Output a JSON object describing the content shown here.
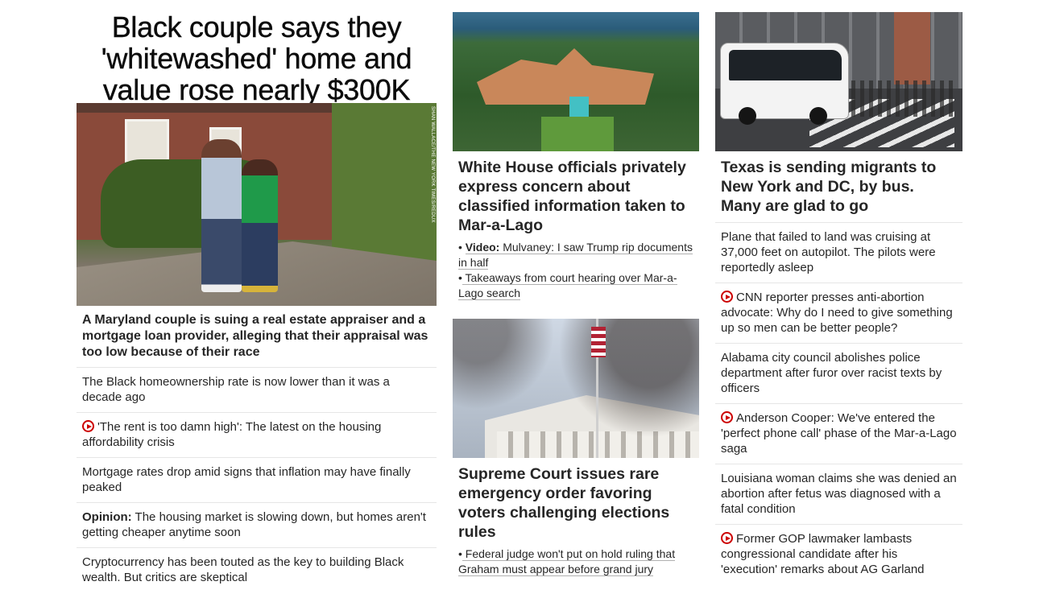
{
  "col1": {
    "headline": "Black couple says they 'whitewashed' home and value rose nearly $300K",
    "photo_credit": "SHAN WALLACE/THE NEW YORK TIMES/REDUX",
    "lead": "A Maryland couple is suing a real estate appraiser and a mortgage loan provider, alleging that their appraisal was too low because of their race",
    "items": [
      {
        "prefix": "",
        "text": "The Black homeownership rate is now lower than it was a decade ago",
        "video": false
      },
      {
        "prefix": "",
        "text": "'The rent is too damn high': The latest on the housing affordability crisis",
        "video": true
      },
      {
        "prefix": "",
        "text": "Mortgage rates drop amid signs that inflation may have finally peaked",
        "video": false
      },
      {
        "prefix": "Opinion:",
        "text": " The housing market is slowing down, but homes aren't getting cheaper anytime soon",
        "video": false
      },
      {
        "prefix": "",
        "text": "Cryptocurrency has been touted as the key to building Black wealth. But critics are skeptical",
        "video": false
      }
    ]
  },
  "col2": {
    "card1": {
      "title": "White House officials privately express concern about classified information taken to Mar-a-Lago",
      "links": [
        {
          "bullet": "•",
          "prefix": "Video:",
          "text": " Mulvaney: I saw Trump rip documents in half"
        },
        {
          "bullet": "•",
          "prefix": "",
          "text": " Takeaways from court hearing over Mar-a-Lago search"
        }
      ]
    },
    "card2": {
      "title": "Supreme Court issues rare emergency order favoring voters challenging elections rules",
      "links": [
        {
          "bullet": "•",
          "prefix": "",
          "text": " Federal judge won't put on hold ruling that Graham must appear before grand jury"
        }
      ]
    }
  },
  "col3": {
    "title": "Texas is sending migrants to New York and DC, by bus. Many are glad to go",
    "items": [
      {
        "text": "Plane that failed to land was cruising at 37,000 feet on autopilot. The pilots were reportedly asleep",
        "video": false
      },
      {
        "text": "CNN reporter presses anti-abortion advocate: Why do I need to give something up so men can be better people?",
        "video": true
      },
      {
        "text": "Alabama city council abolishes police department after furor over racist texts by officers",
        "video": false
      },
      {
        "text": "Anderson Cooper: We've entered the 'perfect phone call' phase of the Mar-a-Lago saga",
        "video": true
      },
      {
        "text": "Louisiana woman claims she was denied an abortion after fetus was diagnosed with a fatal condition",
        "video": false
      },
      {
        "text": "Former GOP lawmaker lambasts congressional candidate after his 'execution' remarks about AG Garland",
        "video": true
      }
    ]
  },
  "colors": {
    "video_icon": "#cc0000",
    "text": "#262626",
    "divider": "#e6e6e6"
  }
}
